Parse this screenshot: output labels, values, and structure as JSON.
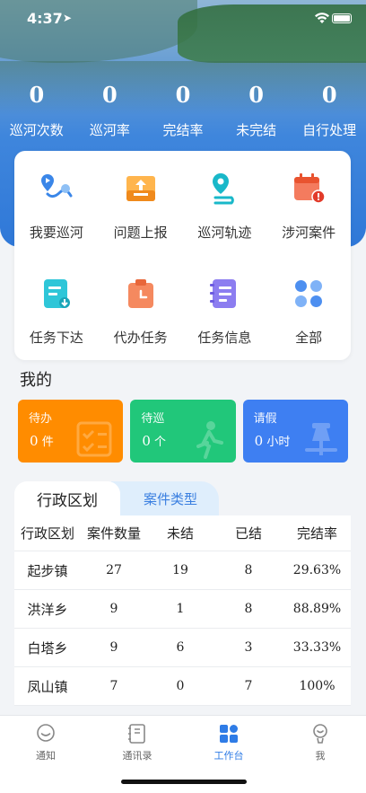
{
  "status_bar": {
    "time": "4:37",
    "location_glyph": "➤"
  },
  "stats": [
    {
      "value": "0",
      "label": "巡河次数"
    },
    {
      "value": "0",
      "label": "巡河率"
    },
    {
      "value": "0",
      "label": "完结率"
    },
    {
      "value": "0",
      "label": "未完结"
    },
    {
      "value": "0",
      "label": "自行处理"
    }
  ],
  "grid": [
    {
      "label": "我要巡河",
      "icon": "river-patrol-icon"
    },
    {
      "label": "问题上报",
      "icon": "report-upload-icon"
    },
    {
      "label": "巡河轨迹",
      "icon": "track-location-icon"
    },
    {
      "label": "涉河案件",
      "icon": "calendar-alert-icon"
    },
    {
      "label": "任务下达",
      "icon": "task-assign-icon"
    },
    {
      "label": "代办任务",
      "icon": "clipboard-task-icon"
    },
    {
      "label": "任务信息",
      "icon": "notebook-icon"
    },
    {
      "label": "全部",
      "icon": "all-grid-icon"
    }
  ],
  "mine": {
    "title": "我的",
    "cards": [
      {
        "title": "待办",
        "value": "0",
        "unit": "件",
        "color": "#ff8c00"
      },
      {
        "title": "待巡",
        "value": "0",
        "unit": "个",
        "color": "#21c77a"
      },
      {
        "title": "请假",
        "value": "0",
        "unit": "小时",
        "color": "#3e7ff2"
      }
    ]
  },
  "region_table": {
    "tabs": {
      "active": "行政区划",
      "inactive": "案件类型"
    },
    "headers": [
      "行政区划",
      "案件数量",
      "未结",
      "已结",
      "完结率"
    ],
    "rows": [
      [
        "起步镇",
        "27",
        "19",
        "8",
        "29.63%"
      ],
      [
        "洪洋乡",
        "9",
        "1",
        "8",
        "88.89%"
      ],
      [
        "白塔乡",
        "9",
        "6",
        "3",
        "33.33%"
      ],
      [
        "凤山镇",
        "7",
        "0",
        "7",
        "100%"
      ]
    ]
  },
  "tabbar": [
    {
      "label": "通知"
    },
    {
      "label": "通讯录"
    },
    {
      "label": "工作台",
      "active": true
    },
    {
      "label": "我"
    }
  ],
  "colors": {
    "primary": "#2f7ce6",
    "orange": "#ff8c00",
    "green": "#21c77a",
    "blue": "#3e7ff2"
  }
}
